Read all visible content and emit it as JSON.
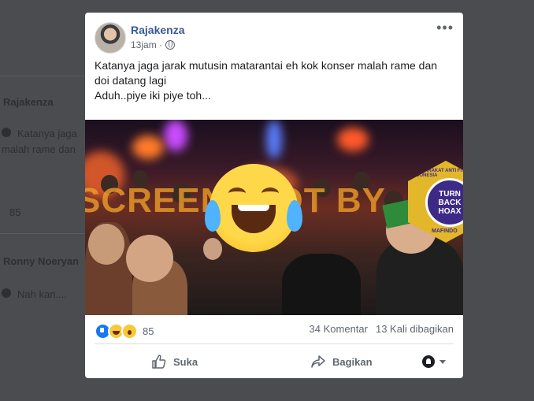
{
  "background": {
    "items": [
      {
        "text": "Rajakenza",
        "bold": true
      },
      {
        "text": "Katanya jaga",
        "bold": false
      },
      {
        "text": "malah rame dan",
        "bold": false
      },
      {
        "text": "85",
        "bold": false
      },
      {
        "text": "Ronny Noeryan",
        "bold": true
      },
      {
        "text": "Nah kan....",
        "bold": false
      }
    ]
  },
  "post": {
    "author": "Rajakenza",
    "time": "13jam ·",
    "more_label": "•••",
    "text_lines": [
      "Katanya jaga jarak mutusin matarantai eh kok konser malah rame dan doi datang lagi",
      "Aduh..piye iki piye toh..."
    ],
    "photo": {
      "watermark": "SCREENSHOT BY",
      "badge_center": "TURN BACK HOAX",
      "badge_ring": "MASYARAKAT ANTI FITNAH INDONESIA",
      "badge_bottom": "MAFINDO"
    },
    "reactions": {
      "icons": [
        "like-reaction-icon",
        "haha-reaction-icon",
        "wow-reaction-icon"
      ],
      "count": "85"
    },
    "comments": "34 Komentar",
    "shares": "13 Kali dibagikan",
    "actions": {
      "like": "Suka",
      "share": "Bagikan"
    }
  }
}
